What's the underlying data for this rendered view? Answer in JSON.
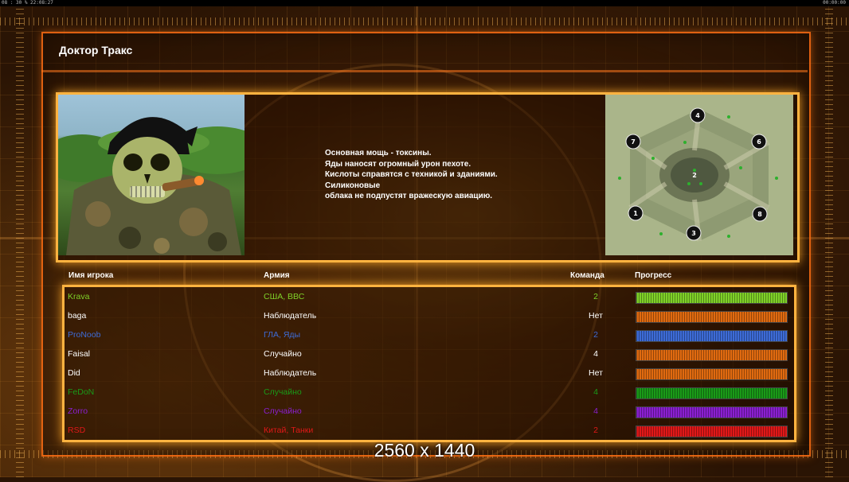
{
  "status_bar": {
    "left_a": "08 : 30 %",
    "left_b": "22:08:27",
    "right": "00:00:00"
  },
  "title": "Доктор Тракс",
  "description": [
    "Основная мощь - токсины.",
    "Яды наносят огромный урон пехоте.",
    "Кислоты справятся с техникой и зданиями.",
    "Силиконовые",
    "облака не подпустят вражескую авиацию."
  ],
  "map": {
    "start_positions": [
      "4",
      "7",
      "6",
      "2",
      "1",
      "8",
      "3"
    ]
  },
  "table": {
    "headers": {
      "name": "Имя игрока",
      "army": "Армия",
      "team": "Команда",
      "progress": "Прогресс"
    },
    "rows": [
      {
        "name": "Krava",
        "army": "США, ВВС",
        "team": "2",
        "color": "#7fd128",
        "bar_color": "#7fd128"
      },
      {
        "name": "baga",
        "army": "Наблюдатель",
        "team": "Нет",
        "color": "#ffffff",
        "bar_color": "#e06a10"
      },
      {
        "name": "ProNoob",
        "army": "ГЛА, Яды",
        "team": "2",
        "color": "#3d6bd6",
        "bar_color": "#3d6bd6"
      },
      {
        "name": "Faisal",
        "army": "Случайно",
        "team": "4",
        "color": "#ffffff",
        "bar_color": "#e06a10"
      },
      {
        "name": "Did",
        "army": "Наблюдатель",
        "team": "Нет",
        "color": "#ffffff",
        "bar_color": "#e06a10"
      },
      {
        "name": "FeDoN",
        "army": "Случайно",
        "team": "4",
        "color": "#1a9a18",
        "bar_color": "#1a9a18"
      },
      {
        "name": "Zorro",
        "army": "Случайно",
        "team": "4",
        "color": "#8a1fd0",
        "bar_color": "#8a1fd0"
      },
      {
        "name": "RSD",
        "army": "Китай, Танки",
        "team": "2",
        "color": "#e01818",
        "bar_color": "#e01818"
      }
    ]
  },
  "resolution_label": "2560 x 1440"
}
